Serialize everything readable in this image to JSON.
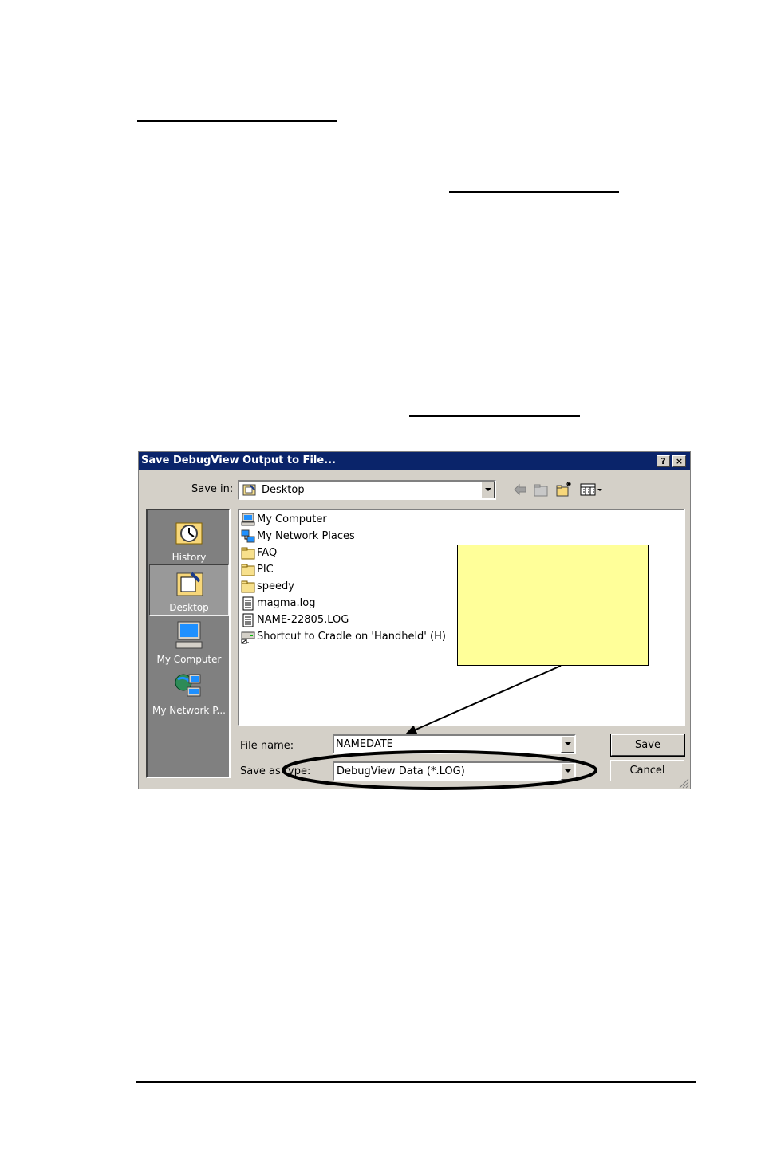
{
  "dialog": {
    "title": "Save DebugView Output to File...",
    "help_button": "?",
    "close_button": "×",
    "save_in_label": "Save in:",
    "save_in_value": "Desktop",
    "file_name_label": "File name:",
    "file_name_value": "NAMEDATE",
    "save_as_type_label": "Save as type:",
    "save_as_type_value": "DebugView Data (*.LOG)",
    "save_button": "Save",
    "cancel_button": "Cancel",
    "places": [
      {
        "label": "History",
        "icon": "history-icon"
      },
      {
        "label": "Desktop",
        "icon": "desktop-icon",
        "selected": true
      },
      {
        "label": "My Computer",
        "icon": "my-computer-icon"
      },
      {
        "label": "My Network P...",
        "icon": "network-places-icon"
      }
    ],
    "files": [
      {
        "name": "My Computer",
        "icon": "computer-icon"
      },
      {
        "name": "My Network Places",
        "icon": "network-icon"
      },
      {
        "name": "FAQ",
        "icon": "folder-icon"
      },
      {
        "name": "PIC",
        "icon": "folder-icon"
      },
      {
        "name": "speedy",
        "icon": "folder-icon"
      },
      {
        "name": "magma.log",
        "icon": "text-file-icon"
      },
      {
        "name": "NAME-22805.LOG",
        "icon": "text-file-icon"
      },
      {
        "name": "Shortcut to Cradle on 'Handheld' (H)",
        "icon": "network-drive-icon"
      }
    ]
  },
  "colors": {
    "titlebar": "#0a246a",
    "callout": "#ffff99",
    "dialog_face": "#d4d0c8"
  }
}
